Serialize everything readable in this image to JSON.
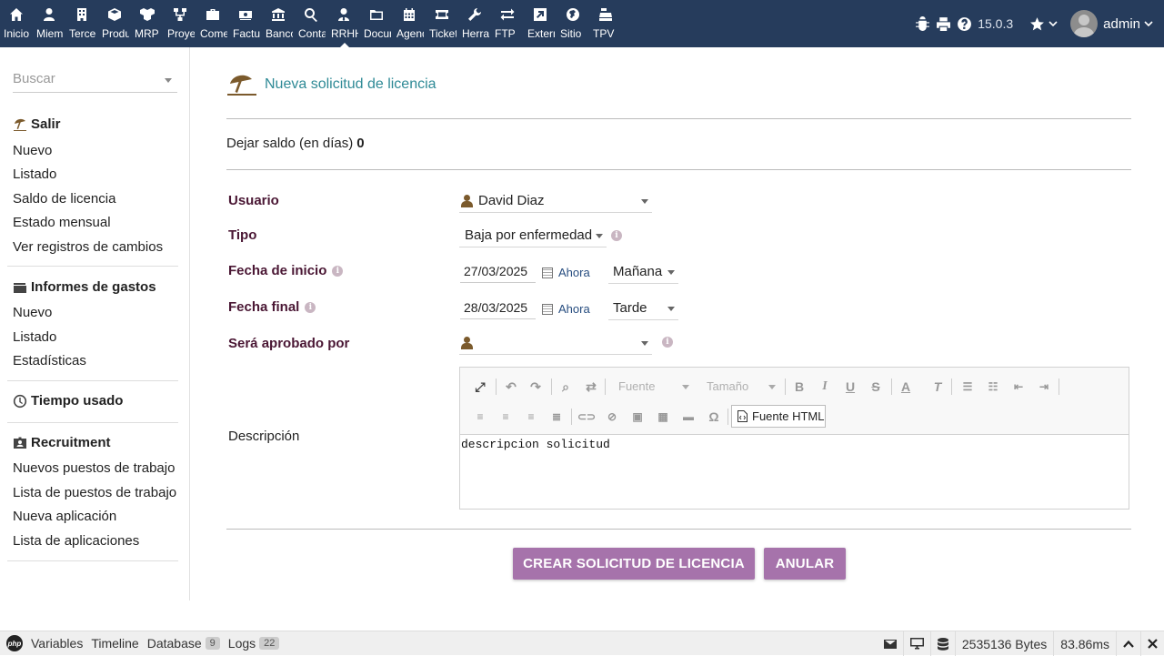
{
  "topnav": [
    {
      "label": "Inicio",
      "icon": "home-icon"
    },
    {
      "label": "Miembros",
      "icon": "user-icon"
    },
    {
      "label": "Terceros",
      "icon": "building-icon"
    },
    {
      "label": "Productos",
      "icon": "cube-icon"
    },
    {
      "label": "MRP",
      "icon": "cubes-icon"
    },
    {
      "label": "Proyectos",
      "icon": "project-icon"
    },
    {
      "label": "Comercial",
      "icon": "suitcase-icon"
    },
    {
      "label": "Facturación",
      "icon": "money-icon"
    },
    {
      "label": "Bancos",
      "icon": "bank-icon"
    },
    {
      "label": "Contabilidad",
      "icon": "search-dollar-icon"
    },
    {
      "label": "RRHH",
      "icon": "user-tie-icon"
    },
    {
      "label": "Documentos",
      "icon": "folder-icon"
    },
    {
      "label": "Agenda",
      "icon": "calendar-icon"
    },
    {
      "label": "Tickets",
      "icon": "ticket-icon"
    },
    {
      "label": "Herramientas",
      "icon": "wrench-icon"
    },
    {
      "label": "FTP",
      "icon": "exchange-icon"
    },
    {
      "label": "Externo",
      "icon": "external-icon"
    },
    {
      "label": "Sitio",
      "icon": "globe-icon"
    },
    {
      "label": "TPV",
      "icon": "cash-register-icon"
    }
  ],
  "topright": {
    "version": "15.0.3",
    "username": "admin"
  },
  "sidebar": {
    "search_placeholder": "Buscar",
    "sections": [
      {
        "title": "Salir",
        "icon": "umbrella-beach-icon",
        "items": [
          "Nuevo",
          "Listado",
          "Saldo de licencia",
          "Estado mensual",
          "Ver registros de cambios"
        ]
      },
      {
        "title": "Informes de gastos",
        "icon": "wallet-icon",
        "items": [
          "Nuevo",
          "Listado",
          "Estadísticas"
        ]
      },
      {
        "title": "Tiempo usado",
        "icon": "clock-icon",
        "items": []
      },
      {
        "title": "Recruitment",
        "icon": "id-badge-icon",
        "items": [
          "Nuevos puestos de trabajo",
          "Lista de puestos de trabajo",
          "Nueva aplicación",
          "Lista de aplicaciones"
        ]
      }
    ]
  },
  "main": {
    "title": "Nueva solicitud de licencia",
    "balance_label": "Dejar saldo (en días)",
    "balance_value": "0",
    "fields": {
      "usuario_label": "Usuario",
      "usuario_value": "David Diaz",
      "tipo_label": "Tipo",
      "tipo_value": "Baja por enfermedad",
      "inicio_label": "Fecha de inicio",
      "inicio_date": "27/03/2025",
      "inicio_now": "Ahora",
      "inicio_half": "Mañana",
      "final_label": "Fecha final",
      "final_date": "28/03/2025",
      "final_now": "Ahora",
      "final_half": "Tarde",
      "aprobado_label": "Será aprobado por",
      "aprobado_value": "",
      "descripcion_label": "Descripción"
    },
    "editor": {
      "font_placeholder": "Fuente",
      "size_placeholder": "Tamaño",
      "source_label": "Fuente HTML",
      "content": "descripcion solicitud"
    },
    "buttons": {
      "create": "CREAR SOLICITUD DE LICENCIA",
      "cancel": "ANULAR"
    }
  },
  "debugbar": {
    "variables": "Variables",
    "timeline": "Timeline",
    "database": "Database",
    "database_count": "9",
    "logs": "Logs",
    "logs_count": "22",
    "bytes": "2535136 Bytes",
    "time": "83.86ms"
  },
  "colors": {
    "topbar": "#263c5c",
    "accent_button": "#a673ab",
    "label": "#4a1734",
    "title": "#2f8a96"
  }
}
